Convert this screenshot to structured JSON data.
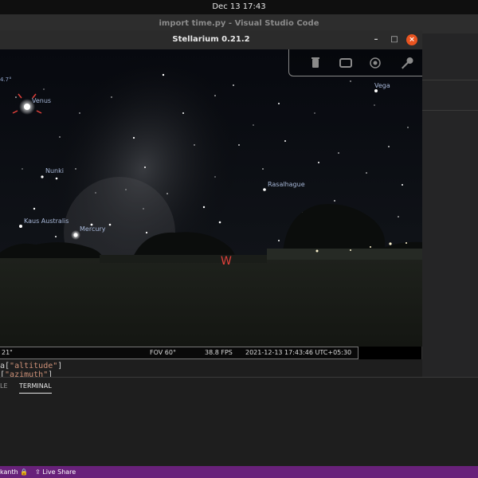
{
  "topbar": {
    "datetime": "Dec 13  17:43"
  },
  "vscode": {
    "title": "import time.py - Visual Studio Code",
    "code": {
      "line1_pre": "a[",
      "line1_str": "\"altitude\"",
      "line1_post": "]",
      "line2_pre": "[",
      "line2_str": "\"azimuth\"",
      "line2_post": "]"
    },
    "panel_tabs": {
      "left": "LE",
      "terminal": "TERMINAL"
    },
    "statusbar": {
      "user": "kanth",
      "live_share": "Live Share"
    }
  },
  "stellarium": {
    "title": "Stellarium 0.21.2",
    "controls": {
      "minimize": "–",
      "maximize": "□",
      "close": "×"
    },
    "labels": {
      "vega": "Vega",
      "venus": "Venus",
      "nunki": "Nunki",
      "rasalhague": "Rasalhague",
      "kaus_australis": "Kaus Australis",
      "mercury": "Mercury",
      "west": "W",
      "edge_value": "4.7°"
    },
    "status": {
      "left": "21\"",
      "fov": "FOV 60°",
      "fps": "38.8 FPS",
      "datetime": "2021-12-13 17:43:46 UTC+05:30"
    },
    "tool_icons": [
      "bin-icon",
      "window-icon",
      "target-icon",
      "wrench-icon"
    ]
  },
  "colors": {
    "accent_close": "#e95420",
    "statusbar": "#68217a",
    "label": "#a8b8d8",
    "west": "#e0403a"
  }
}
